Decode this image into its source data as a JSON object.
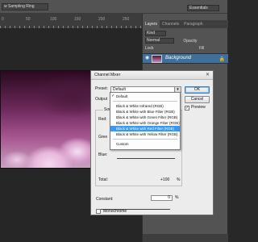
{
  "toolbar": {
    "sample_label": "w Sampling Ring",
    "workspace": "Essentials"
  },
  "ruler": {
    "numbers": [
      "0",
      "50",
      "100",
      "150",
      "200",
      "250"
    ]
  },
  "panel": {
    "tabs": [
      "Layers",
      "Channels",
      "Paragraph"
    ],
    "kind": "Kind",
    "blend": "Normal",
    "opacity_label": "Opacity",
    "lock_label": "Lock",
    "fill_label": "Fill",
    "layer_name": "Background"
  },
  "dialog": {
    "title": "Channel Mixer",
    "close_glyph": "✕",
    "preset_label": "Preset:",
    "preset_value": "Default",
    "output_label": "Output",
    "source_label": "Sour",
    "red_label": "Red:",
    "green_label": "Gree",
    "blue_label": "Blue:",
    "total_label": "Total:",
    "total_value": "+100",
    "total_unit": "%",
    "constant_label": "Constant:",
    "constant_value": "0",
    "constant_unit": "%",
    "monochrome_label": "Monochrome",
    "preview_label": "Preview",
    "ok_label": "OK",
    "cancel_label": "Cancel"
  },
  "dropdown": {
    "items": [
      {
        "label": "Default",
        "checked": true
      },
      {
        "label": "Black & White Infrared (RGB)"
      },
      {
        "label": "Black & White with Blue Filter (RGB)"
      },
      {
        "label": "Black & White with Green Filter (RGB)"
      },
      {
        "label": "Black & White with Orange Filter (RGB)"
      },
      {
        "label": "Black & White with Red Filter (RGB)",
        "highlighted": true
      },
      {
        "label": "Black & White with Yellow Filter (RGB)"
      },
      {
        "label": "Custom"
      }
    ]
  }
}
